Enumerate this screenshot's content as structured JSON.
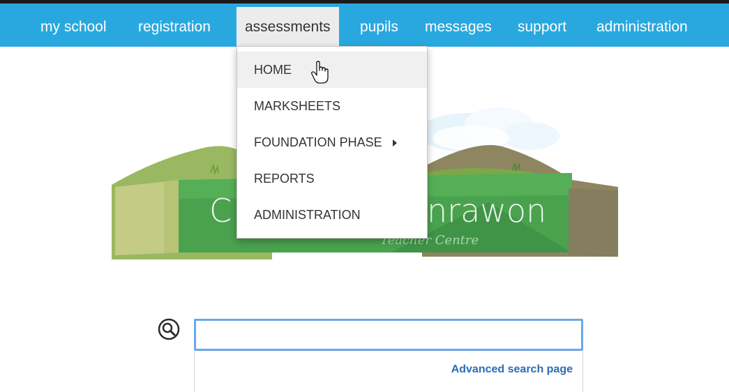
{
  "nav": {
    "items": [
      {
        "label": "my school"
      },
      {
        "label": "registration"
      },
      {
        "label": "assessments",
        "active": true
      },
      {
        "label": "pupils"
      },
      {
        "label": "messages"
      },
      {
        "label": "support"
      },
      {
        "label": "administration"
      }
    ]
  },
  "dropdown": {
    "items": [
      {
        "label": "HOME",
        "hovered": true
      },
      {
        "label": "MARKSHEETS"
      },
      {
        "label": "FOUNDATION PHASE",
        "has_submenu": true
      },
      {
        "label": "REPORTS"
      },
      {
        "label": "ADMINISTRATION"
      }
    ]
  },
  "banner": {
    "title_left": "C",
    "title_right": "nrawon",
    "subtitle": "Teacher Centre"
  },
  "search": {
    "value": "",
    "placeholder": "",
    "advanced_link": "Advanced search page"
  },
  "colors": {
    "nav_bg": "#29a8e0",
    "active_tab_bg": "#ececec",
    "link": "#2b6cb8",
    "input_border": "#6aa8e8"
  },
  "icons": [
    "search-icon",
    "hand-cursor-icon",
    "submenu-arrow-icon"
  ]
}
